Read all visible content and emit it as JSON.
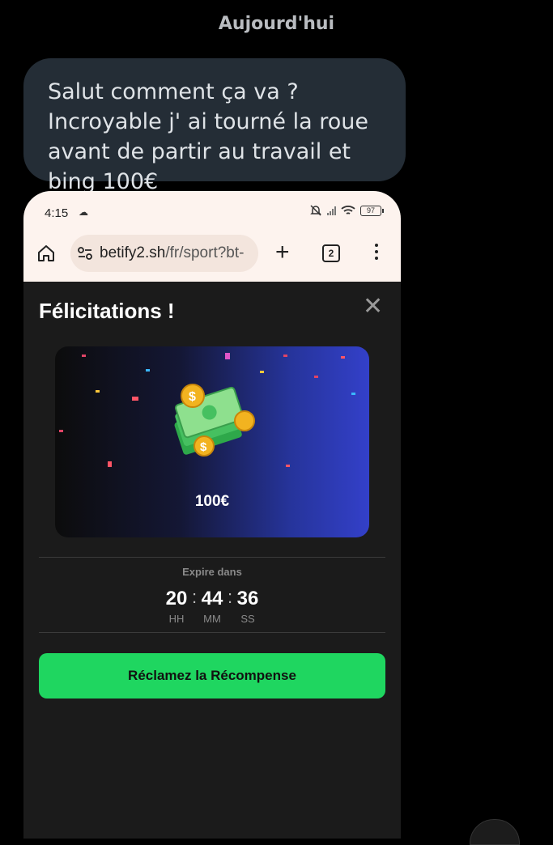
{
  "chat": {
    "date_label": "Aujourd'hui",
    "message_text": "Salut comment ça va ? Incroyable j' ai tourné la roue avant de partir au travail et bing 100€"
  },
  "phone": {
    "status_time": "4:15",
    "battery_level": "97",
    "url_domain": "betify2.sh",
    "url_path": "/fr/sport?bt-",
    "tab_count": "2"
  },
  "popup": {
    "title": "Félicitations !",
    "reward_amount": "100€",
    "expire_label": "Expire dans",
    "timer": {
      "hours": "20",
      "minutes": "44",
      "seconds": "36",
      "hours_label": "HH",
      "minutes_label": "MM",
      "seconds_label": "SS"
    },
    "claim_label": "Réclamez la Récompense"
  },
  "colors": {
    "page_bg": "#000000",
    "bubble_bg": "#242d36",
    "popup_bg": "#1b1b1b",
    "browser_bar": "#fdf3ee",
    "claim_button": "#1fd660",
    "banner_gradient_end": "#3340c9"
  },
  "icons": [
    "home-icon",
    "site-settings-icon",
    "plus-icon",
    "tabs-icon",
    "more-icon",
    "close-icon",
    "money-icon",
    "cloud-icon",
    "bell-muted-icon",
    "wifi-icon",
    "battery-icon"
  ]
}
